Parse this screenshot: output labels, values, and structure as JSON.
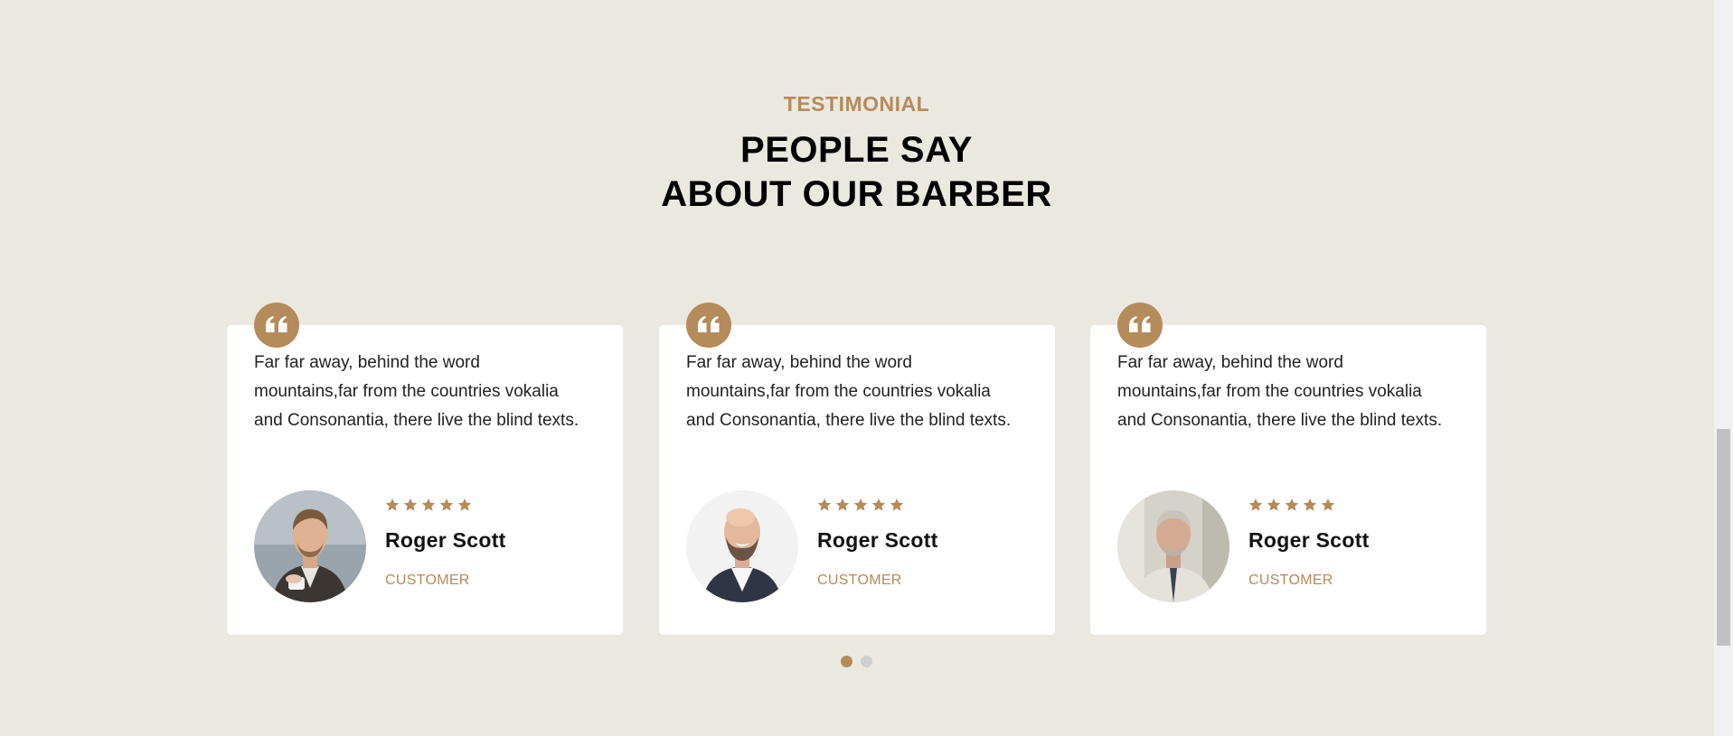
{
  "section": {
    "subheading": "TESTIMONIAL",
    "title_line1": "PEOPLE SAY",
    "title_line2": "ABOUT OUR BARBER"
  },
  "colors": {
    "accent": "#b48b5a",
    "background": "#ebe8e0",
    "card": "#ffffff"
  },
  "testimonials": [
    {
      "text": "Far far away, behind the word mountains,far from the countries vokalia and Consonantia, there live the blind texts.",
      "name": "Roger Scott",
      "role": "CUSTOMER",
      "rating": 5,
      "avatar_icon": "person-avatar"
    },
    {
      "text": "Far far away, behind the word mountains,far from the countries vokalia and Consonantia, there live the blind texts.",
      "name": "Roger Scott",
      "role": "CUSTOMER",
      "rating": 5,
      "avatar_icon": "person-avatar"
    },
    {
      "text": "Far far away, behind the word mountains,far from the countries vokalia and Consonantia, there live the blind texts.",
      "name": "Roger Scott",
      "role": "CUSTOMER",
      "rating": 5,
      "avatar_icon": "person-avatar"
    }
  ],
  "carousel": {
    "pages": 2,
    "active_page": 1
  }
}
